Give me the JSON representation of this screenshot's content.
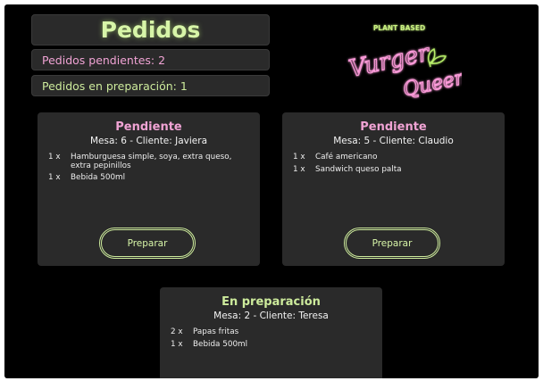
{
  "header": {
    "title": "Pedidos",
    "pending_text": "Pedidos pendientes: 2",
    "in_prep_text": "Pedidos en preparación: 1"
  },
  "logo": {
    "tagline": "PLANT BASED",
    "word1": "Vurger",
    "word2": "Queen",
    "pink": "#ff8fd8",
    "green": "#b8ef6a"
  },
  "orders": [
    {
      "status": "Pendiente",
      "table": "Mesa: 6 - Cliente: Javiera",
      "items": [
        {
          "qty": "1 x",
          "name": "Hamburguesa simple, soya, extra queso, extra pepinillos"
        },
        {
          "qty": "1 x",
          "name": "Bebida 500ml"
        }
      ],
      "action": "Preparar"
    },
    {
      "status": "Pendiente",
      "table": "Mesa: 5 - Cliente: Claudio",
      "items": [
        {
          "qty": "1 x",
          "name": "Café americano"
        },
        {
          "qty": "1 x",
          "name": "Sandwich queso palta"
        }
      ],
      "action": "Preparar"
    },
    {
      "status": "En preparación",
      "table": "Mesa: 2 - Cliente: Teresa",
      "items": [
        {
          "qty": "2 x",
          "name": "Papas fritas"
        },
        {
          "qty": "1 x",
          "name": "Bebida 500ml"
        }
      ]
    }
  ],
  "colors": {
    "background": "#000000",
    "panel": "#2a2a2a",
    "pending_accent": "#f0a3d4",
    "prep_accent": "#cdeb9c"
  }
}
